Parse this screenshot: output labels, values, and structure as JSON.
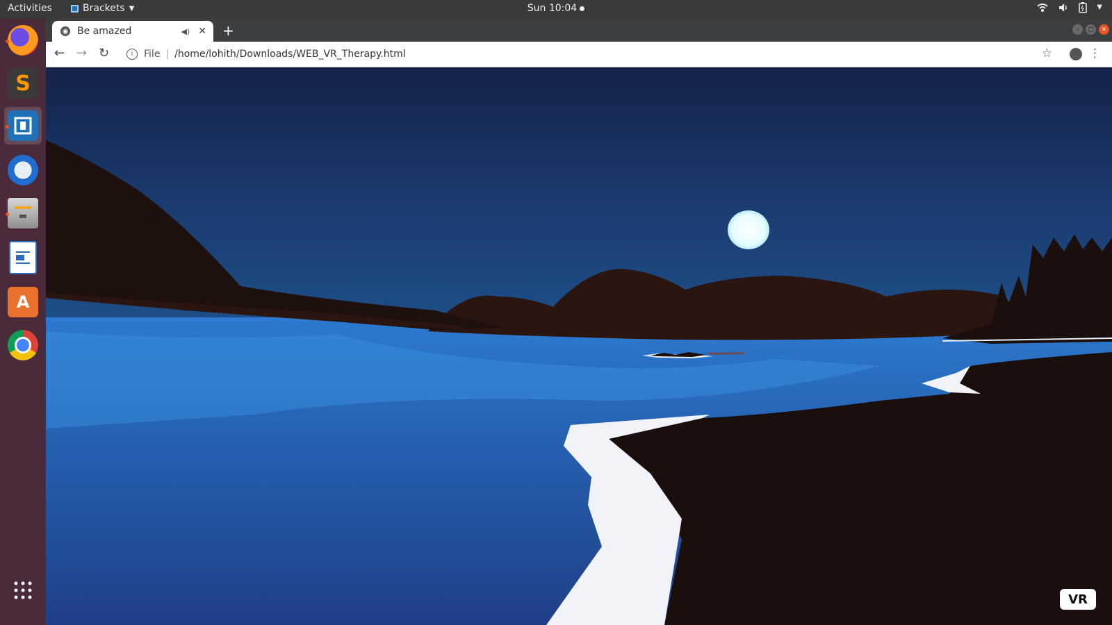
{
  "topbar": {
    "activities": "Activities",
    "app_name": "Brackets",
    "clock": "Sun 10:04"
  },
  "dock": {
    "items": [
      "firefox",
      "sublime-text",
      "brackets",
      "thunderbird",
      "files",
      "libreoffice-writer",
      "ubuntu-software",
      "chrome"
    ],
    "show_apps": "show-apps"
  },
  "browser": {
    "tab_title": "Be amazed",
    "new_tab": "+",
    "url_scheme": "File",
    "url": "/home/lohith/Downloads/WEB_VR_Therapy.html"
  },
  "scene": {
    "vr_button": "VR"
  },
  "colors": {
    "sky_top": "#142248",
    "sky_bottom": "#1f4f86",
    "water": "#2a6bbf",
    "land": "#1a0f0c",
    "moon": "#e8fbff",
    "dock_bg": "#4b2b3b",
    "accent": "#e95420"
  }
}
